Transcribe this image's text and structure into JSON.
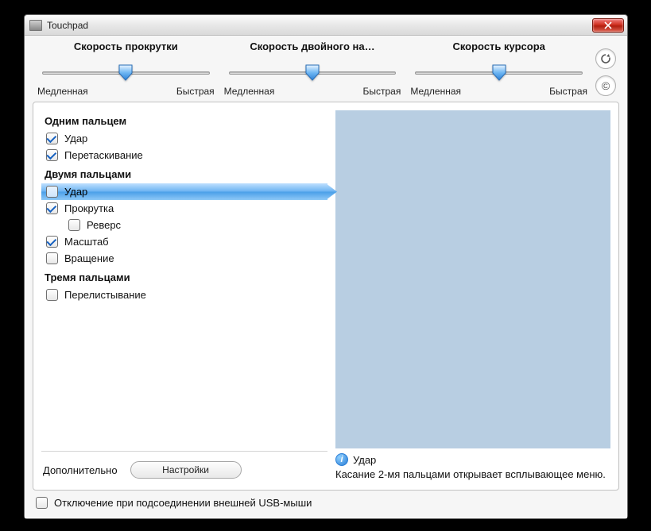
{
  "window": {
    "title": "Touchpad"
  },
  "sliders": [
    {
      "title": "Скорость прокрутки",
      "min_label": "Медленная",
      "max_label": "Быстрая",
      "position_pct": 50
    },
    {
      "title": "Скорость двойного на…",
      "min_label": "Медленная",
      "max_label": "Быстрая",
      "position_pct": 50
    },
    {
      "title": "Скорость курсора",
      "min_label": "Медленная",
      "max_label": "Быстрая",
      "position_pct": 50
    }
  ],
  "sections": {
    "one_finger": {
      "header": "Одним пальцем",
      "items": [
        {
          "label": "Удар",
          "checked": true
        },
        {
          "label": "Перетаскивание",
          "checked": true
        }
      ]
    },
    "two_finger": {
      "header": "Двумя пальцами",
      "items": [
        {
          "label": "Удар",
          "checked": false,
          "selected": true
        },
        {
          "label": "Прокрутка",
          "checked": true
        },
        {
          "label": "Реверс",
          "checked": false,
          "indent": true
        },
        {
          "label": "Масштаб",
          "checked": true
        },
        {
          "label": "Вращение",
          "checked": false
        }
      ]
    },
    "three_finger": {
      "header": "Тремя пальцами",
      "items": [
        {
          "label": "Перелистывание",
          "checked": false
        }
      ]
    }
  },
  "hint": {
    "title": "Удар",
    "text": "Касание 2-мя пальцами открывает всплывающее меню."
  },
  "footer": {
    "label": "Дополнительно",
    "settings_button": "Настройки"
  },
  "bottom_checkbox": {
    "label": "Отключение при подсоединении внешней USB-мыши",
    "checked": false
  }
}
